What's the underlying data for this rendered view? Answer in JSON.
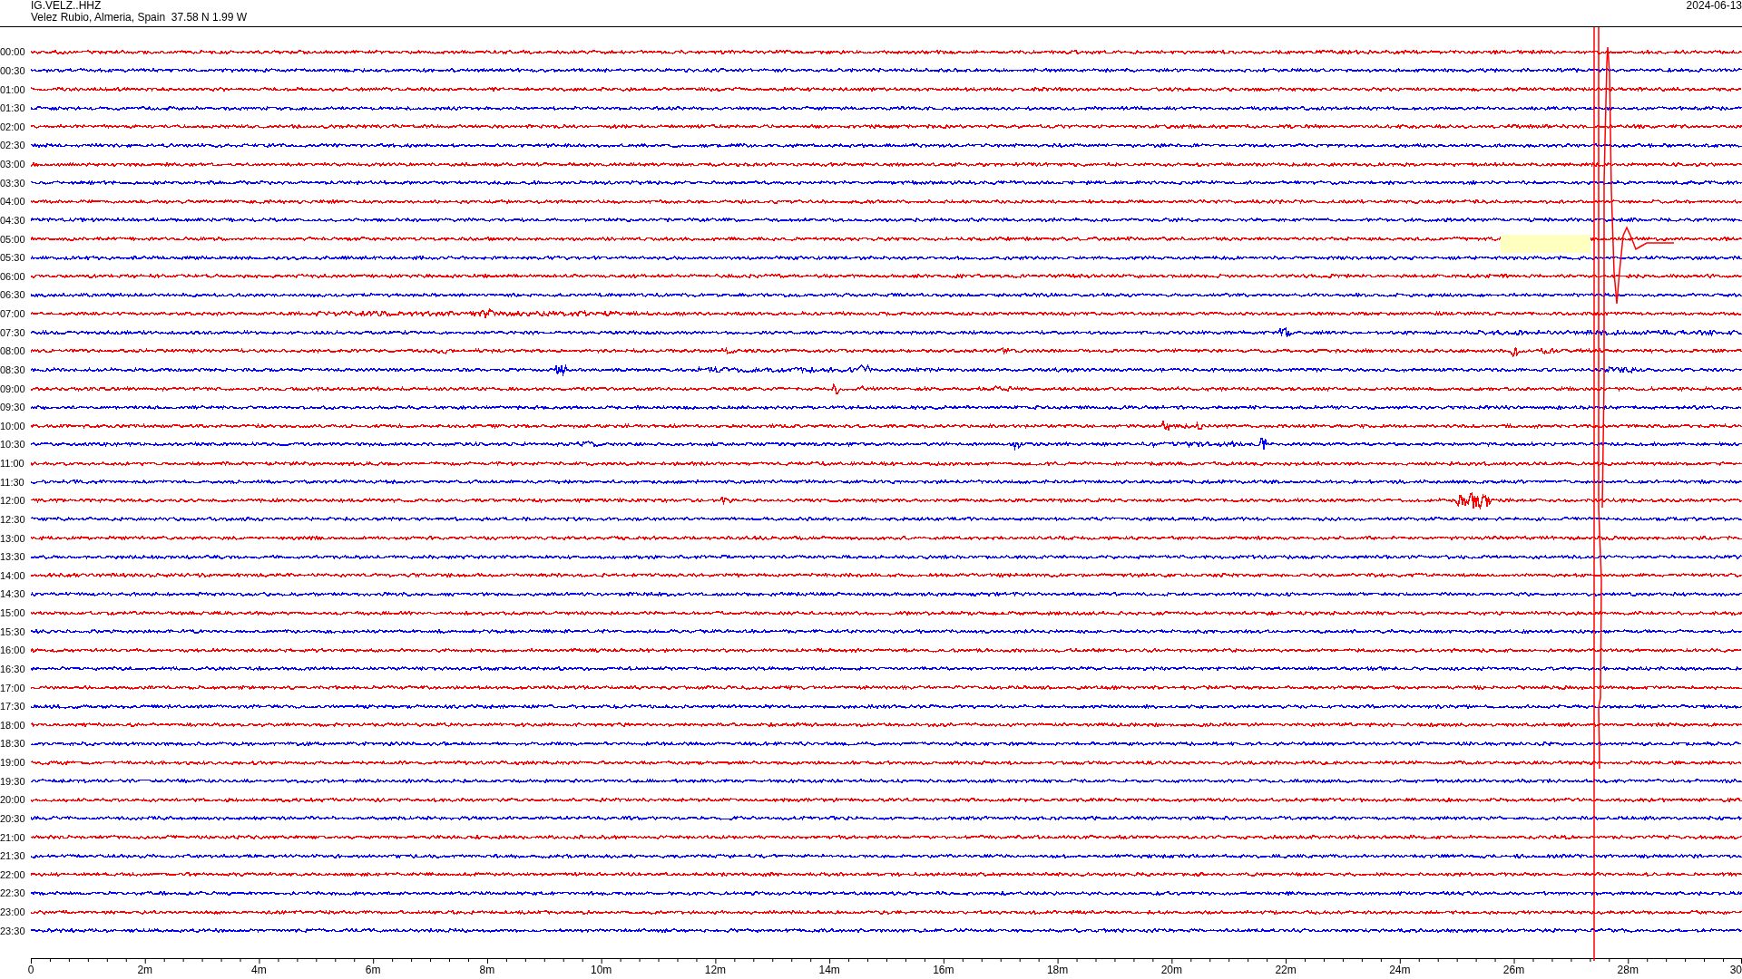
{
  "header": {
    "station": "IG.VELZ..HHZ",
    "location": "Velez Rubio, Almeria, Spain  37.58 N 1.99 W",
    "date": "2024-06-13"
  },
  "rows": [
    {
      "label": "00:00",
      "color": "#ff0000"
    },
    {
      "label": "00:30",
      "color": "#0000ff"
    },
    {
      "label": "01:00",
      "color": "#ff0000"
    },
    {
      "label": "01:30",
      "color": "#0000ff"
    },
    {
      "label": "02:00",
      "color": "#ff0000"
    },
    {
      "label": "02:30",
      "color": "#0000ff"
    },
    {
      "label": "03:00",
      "color": "#ff0000"
    },
    {
      "label": "03:30",
      "color": "#0000ff"
    },
    {
      "label": "04:00",
      "color": "#ff0000"
    },
    {
      "label": "04:30",
      "color": "#0000ff"
    },
    {
      "label": "05:00",
      "color": "#ff0000"
    },
    {
      "label": "05:30",
      "color": "#0000ff"
    },
    {
      "label": "06:00",
      "color": "#ff0000"
    },
    {
      "label": "06:30",
      "color": "#0000ff"
    },
    {
      "label": "07:00",
      "color": "#ff0000"
    },
    {
      "label": "07:30",
      "color": "#0000ff"
    },
    {
      "label": "08:00",
      "color": "#ff0000"
    },
    {
      "label": "08:30",
      "color": "#0000ff"
    },
    {
      "label": "09:00",
      "color": "#ff0000"
    },
    {
      "label": "09:30",
      "color": "#0000ff"
    },
    {
      "label": "10:00",
      "color": "#ff0000"
    },
    {
      "label": "10:30",
      "color": "#0000ff"
    },
    {
      "label": "11:00",
      "color": "#ff0000"
    },
    {
      "label": "11:30",
      "color": "#0000ff"
    },
    {
      "label": "12:00",
      "color": "#ff0000"
    },
    {
      "label": "12:30",
      "color": "#0000ff"
    },
    {
      "label": "13:00",
      "color": "#ff0000"
    },
    {
      "label": "13:30",
      "color": "#0000ff"
    },
    {
      "label": "14:00",
      "color": "#ff0000"
    },
    {
      "label": "14:30",
      "color": "#0000ff"
    },
    {
      "label": "15:00",
      "color": "#ff0000"
    },
    {
      "label": "15:30",
      "color": "#0000ff"
    },
    {
      "label": "16:00",
      "color": "#ff0000"
    },
    {
      "label": "16:30",
      "color": "#0000ff"
    },
    {
      "label": "17:00",
      "color": "#ff0000"
    },
    {
      "label": "17:30",
      "color": "#0000ff"
    },
    {
      "label": "18:00",
      "color": "#ff0000"
    },
    {
      "label": "18:30",
      "color": "#0000ff"
    },
    {
      "label": "19:00",
      "color": "#ff0000"
    },
    {
      "label": "19:30",
      "color": "#0000ff"
    },
    {
      "label": "20:00",
      "color": "#ff0000"
    },
    {
      "label": "20:30",
      "color": "#0000ff"
    },
    {
      "label": "21:00",
      "color": "#ff0000"
    },
    {
      "label": "21:30",
      "color": "#0000ff"
    },
    {
      "label": "22:00",
      "color": "#ff0000"
    },
    {
      "label": "22:30",
      "color": "#0000ff"
    },
    {
      "label": "23:00",
      "color": "#ff0000"
    },
    {
      "label": "23:30",
      "color": "#0000ff"
    }
  ],
  "x_axis": {
    "labels": [
      "0",
      "2m",
      "4m",
      "6m",
      "8m",
      "10m",
      "12m",
      "14m",
      "16m",
      "18m",
      "20m",
      "22m",
      "24m",
      "26m",
      "28m",
      "30"
    ]
  }
}
